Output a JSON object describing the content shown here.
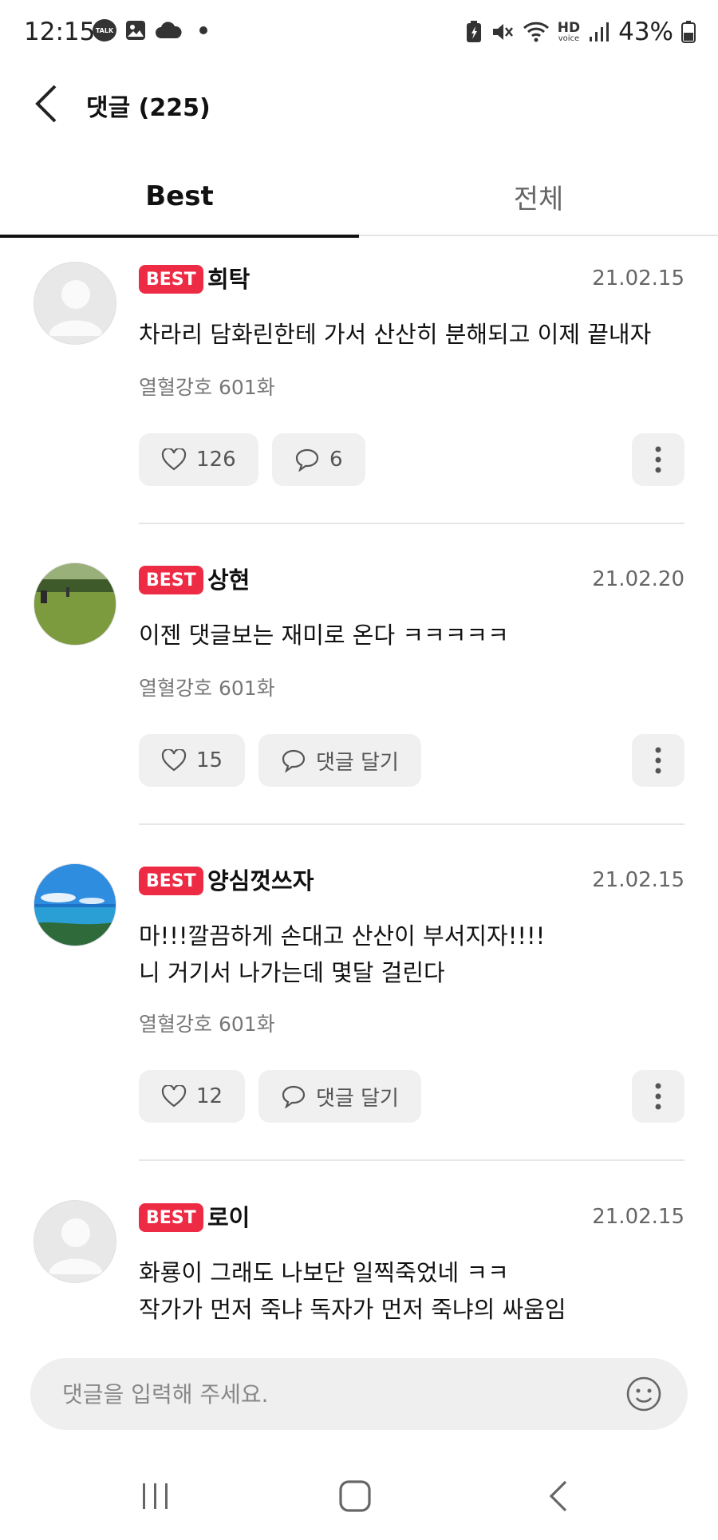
{
  "status_bar": {
    "time": "12:15",
    "talk_label": "TALK",
    "hd_label": "HD",
    "voice_label": "voice",
    "battery": "43%"
  },
  "header": {
    "title": "댓글 (225)"
  },
  "tabs": [
    {
      "label": "Best",
      "active": true
    },
    {
      "label": "전체",
      "active": false
    }
  ],
  "comments": [
    {
      "badge": "BEST",
      "username": "희탁",
      "date": "21.02.15",
      "text": "차라리 담화린한테 가서 산산히 분해되고 이제 끝내자",
      "episode": "열혈강호 601화",
      "likes": "126",
      "reply": "6",
      "avatar": "default"
    },
    {
      "badge": "BEST",
      "username": "상현",
      "date": "21.02.20",
      "text": "이젠  댓글보는 재미로 온다 ㅋㅋㅋㅋㅋ",
      "episode": "열혈강호 601화",
      "likes": "15",
      "reply": "댓글 달기",
      "avatar": "field-photo"
    },
    {
      "badge": "BEST",
      "username": "양심껏쓰자",
      "date": "21.02.15",
      "text": "마!!!깔끔하게 손대고 산산이 부서지자!!!!\n니 거기서 나가는데 몇달 걸린다",
      "episode": "열혈강호 601화",
      "likes": "12",
      "reply": "댓글 달기",
      "avatar": "sea-photo"
    },
    {
      "badge": "BEST",
      "username": "로이",
      "date": "21.02.15",
      "text": "화룡이 그래도 나보단 일찍죽었네 ㅋㅋ\n작가가 먼저 죽냐 독자가 먼저 죽냐의 싸움임",
      "avatar": "default"
    }
  ],
  "input": {
    "placeholder": "댓글을 입력해 주세요."
  },
  "colors": {
    "badge": "#ee2b44",
    "button_bg": "#f0f0f0",
    "input_bg": "#efefef"
  }
}
